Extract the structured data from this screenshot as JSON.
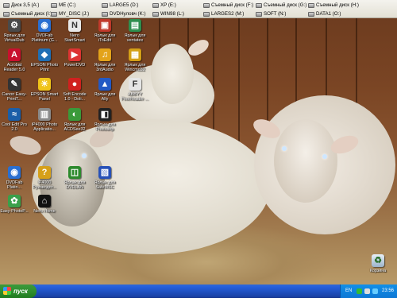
{
  "drives": [
    {
      "label": "Диск 3,5 (A:)"
    },
    {
      "label": "ME (C:)"
    },
    {
      "label": "LARGE5 (D:)"
    },
    {
      "label": "XP (E:)"
    },
    {
      "label": "Съемный диск (F:)"
    },
    {
      "label": "Съемный диск (G:)"
    },
    {
      "label": "Съемный диск (H:)"
    },
    {
      "label": "Съемный диск (I:)"
    },
    {
      "label": "MY_DISC (J:)"
    },
    {
      "label": "DVDНуловч (K:)"
    },
    {
      "label": "WIN98 (L:)"
    },
    {
      "label": "LARGES2 (M:)"
    },
    {
      "label": "SOFT (N:)"
    },
    {
      "label": "DATA1 (O:)"
    }
  ],
  "icons": [
    {
      "label": "Ярлык для VirtualDub",
      "icon": "virtualdub-icon",
      "color": "#4a4a4a",
      "glyph": "⚙"
    },
    {
      "label": "DVDFab Platinum (G...",
      "icon": "dvdfab-icon",
      "color": "#2a6fd1",
      "glyph": "◉"
    },
    {
      "label": "Nero StartSmart",
      "icon": "nero-icon",
      "color": "#e8e8e8",
      "glyph": "N"
    },
    {
      "label": "Ярлык для iToEdit",
      "icon": "itoedit-icon",
      "color": "#c0392b",
      "glyph": "▣"
    },
    {
      "label": "Ярлык для ventatex",
      "icon": "ventatex-icon",
      "color": "#2f8f4f",
      "glyph": "▤"
    },
    {
      "label": "Acrobat Reader 5.0",
      "icon": "acrobat-icon",
      "color": "#c8102e",
      "glyph": "A"
    },
    {
      "label": "EPSON Photo Print",
      "icon": "epson-print-icon",
      "color": "#1f6fb5",
      "glyph": "◆"
    },
    {
      "label": "PowerDVD",
      "icon": "powerdvd-icon",
      "color": "#d33",
      "glyph": "▶"
    },
    {
      "label": "Ярлык для 3rdAudio",
      "icon": "audio-icon",
      "color": "#e3a31a",
      "glyph": "♫"
    },
    {
      "label": "Ярлык для Wincmd32",
      "icon": "wincmd-icon",
      "color": "#d4a017",
      "glyph": "▦"
    },
    {
      "label": "Canon Easy-PrintT...",
      "icon": "canon-icon",
      "color": "#333",
      "glyph": "✎"
    },
    {
      "label": "EPSON Smart Panel",
      "icon": "epson-panel-icon",
      "color": "#f0c419",
      "glyph": "☀"
    },
    {
      "label": "Soft Encode 1.0 - Doli...",
      "icon": "softencode-icon",
      "color": "#d0211f",
      "glyph": "●"
    },
    {
      "label": "Ярлык для Ally",
      "icon": "ally-icon",
      "color": "#2359c4",
      "glyph": "▲"
    },
    {
      "label": "ABBYY FineReader ...",
      "icon": "abbyy-icon",
      "color": "#e5e5e5",
      "glyph": "F"
    },
    {
      "label": "Cool Edit Pro 2.0",
      "icon": "cooledit-icon",
      "color": "#1b5ea8",
      "glyph": "≈"
    },
    {
      "label": "iP4000 Photo Applicatio...",
      "icon": "ip4000-photo-icon",
      "color": "#8a8a8a",
      "glyph": "▥"
    },
    {
      "label": "Ярлык для ACDSee32",
      "icon": "acdsee-icon",
      "color": "#3a9a3a",
      "glyph": "◐"
    },
    {
      "label": "Ярлык для Photoshp",
      "icon": "photoshop-icon",
      "color": "#222",
      "glyph": "◧"
    },
    {
      "label": "DVDFab Platin...",
      "icon": "dvdfab-platinum-icon",
      "color": "#2a6fd1",
      "glyph": "◉"
    },
    {
      "label": "iP4000 Руководст...",
      "icon": "ip4000-guide-icon",
      "color": "#d6a019",
      "glyph": "?"
    },
    {
      "label": "Ярлык для DVDLAN",
      "icon": "dvdlan-icon",
      "color": "#2d8a2d",
      "glyph": "◫"
    },
    {
      "label": "Ярлык для SafeMSC",
      "icon": "safemsc-icon",
      "color": "#2751b8",
      "glyph": "▧"
    },
    {
      "label": "Easy-PhotoP...",
      "icon": "easyphoto-icon",
      "color": "#3aa04a",
      "glyph": "✿"
    },
    {
      "label": "Nero Home",
      "icon": "nero-home-icon",
      "color": "#111",
      "glyph": "⌂"
    }
  ],
  "recycle_bin": {
    "label": "Корзина",
    "icon": "recycle-bin-icon"
  },
  "taskbar": {
    "start_label": "пуск",
    "language": "EN",
    "clock": "23:56"
  }
}
